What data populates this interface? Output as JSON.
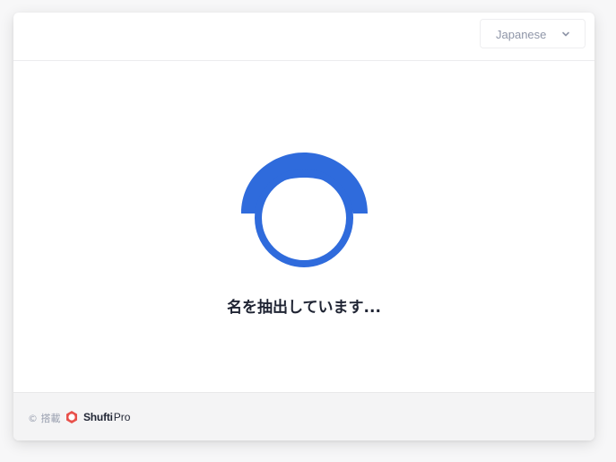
{
  "header": {
    "language": {
      "selected": "Japanese",
      "icon": "chevron-down-icon"
    }
  },
  "main": {
    "status_text": "名を抽出しています...",
    "loader_icon": "loading-spinner-icon",
    "accent_color": "#2f6bdc"
  },
  "footer": {
    "powered_by": "© 搭載",
    "brand_name": "Shufti",
    "brand_suffix": "Pro",
    "brand_icon": "shufti-pro-logo-icon",
    "brand_color": "#e8514b"
  }
}
